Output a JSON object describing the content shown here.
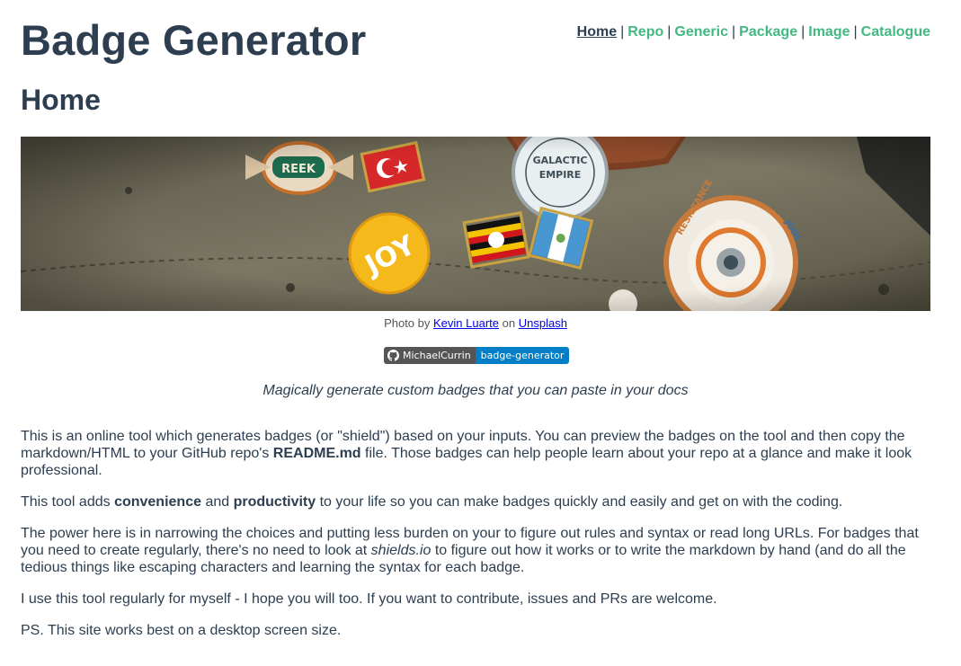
{
  "header": {
    "site_title": "Badge Generator",
    "nav": [
      {
        "label": "Home",
        "active": true
      },
      {
        "label": "Repo",
        "active": false
      },
      {
        "label": "Generic",
        "active": false
      },
      {
        "label": "Package",
        "active": false
      },
      {
        "label": "Image",
        "active": false
      },
      {
        "label": "Catalogue",
        "active": false
      }
    ],
    "nav_separator": "|"
  },
  "main": {
    "heading": "Home",
    "hero_caption": {
      "prefix": "Photo by",
      "author": "Kevin Luarte",
      "middle": "on",
      "source": "Unsplash"
    },
    "repo_badge": {
      "owner": "MichaelCurrin",
      "repo": "badge-generator",
      "icon": "github-icon",
      "left_color": "#555555",
      "right_color": "#007ec6"
    },
    "tagline": "Magically generate custom badges that you can paste in your docs",
    "paragraphs": {
      "p1": {
        "a": "This is an online tool which generates badges (or \"shield\") based on your inputs. You can preview the badges on the tool and then copy the markdown/HTML to your GitHub repo's ",
        "b": "README.md",
        "c": " file. Those badges can help people learn about your repo at a glance and make it look professional."
      },
      "p2": {
        "a": "This tool adds ",
        "b": "convenience",
        "c": " and ",
        "d": "productivity",
        "e": " to your life so you can make badges quickly and easily and get on with the coding."
      },
      "p3": {
        "a": "The power here is in narrowing the choices and putting less burden on your to figure out rules and syntax or read long URLs. For badges that you need to create regularly, there's no need to look at ",
        "b": "shields.io",
        "c": " to figure out how it works or to write the markdown by hand (and do all the tedious things like escaping characters and learning the syntax for each badge."
      },
      "p4": "I use this tool regularly for myself - I hope you will too. If you want to contribute, issues and PRs are welcome.",
      "p5": "PS. This site works best on a desktop screen size."
    }
  },
  "colors": {
    "text": "#2c3e50",
    "link_accent": "#42b983"
  }
}
